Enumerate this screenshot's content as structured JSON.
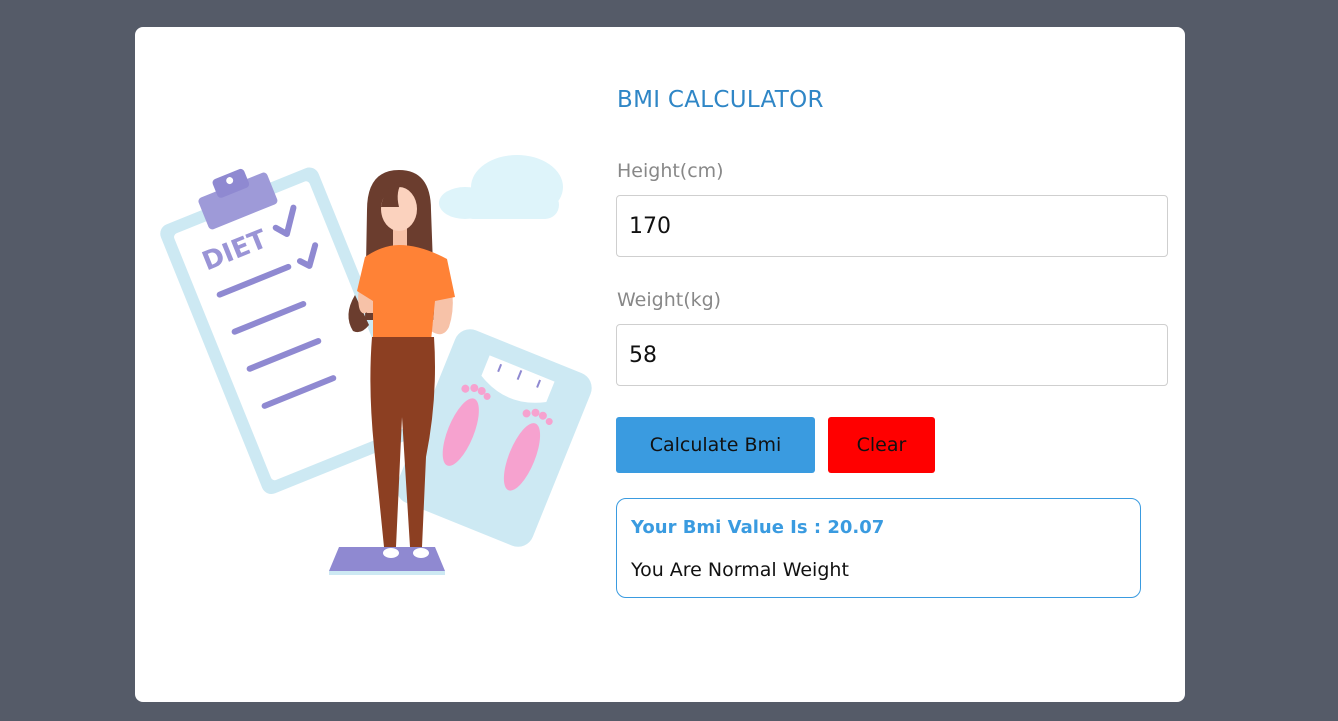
{
  "app": {
    "title": "BMI CALCULATOR"
  },
  "form": {
    "height": {
      "label": "Height(cm)",
      "value": "170"
    },
    "weight": {
      "label": "Weight(kg)",
      "value": "58"
    }
  },
  "buttons": {
    "calculate_label": "Calculate Bmi",
    "clear_label": "Clear"
  },
  "result": {
    "value_text": "Your Bmi Value Is : 20.07",
    "status_text": "You Are Normal Weight"
  },
  "illustration": {
    "clipboard_text": "DIET",
    "icon": "woman-on-scale-diet-illustration"
  },
  "colors": {
    "page_background": "#555b68",
    "card_background": "#ffffff",
    "accent": "#3a9be0",
    "title": "#2f86c6",
    "clear_button": "#ff0000",
    "label": "#888888"
  }
}
